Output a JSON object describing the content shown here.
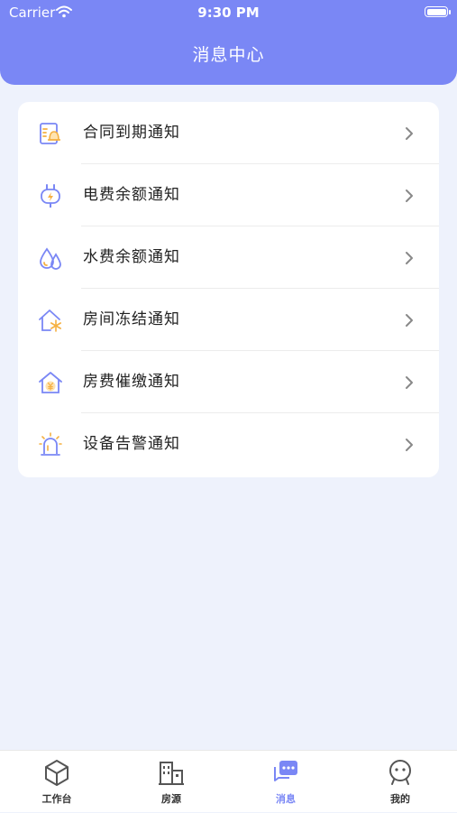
{
  "status_bar": {
    "carrier": "Carrier",
    "time": "9:30 PM"
  },
  "header": {
    "title": "消息中心"
  },
  "notifications": [
    {
      "label": "合同到期通知",
      "icon": "contract-bell-icon"
    },
    {
      "label": "电费余额通知",
      "icon": "power-plug-icon"
    },
    {
      "label": "水费余额通知",
      "icon": "water-drops-icon"
    },
    {
      "label": "房间冻结通知",
      "icon": "house-snowflake-icon"
    },
    {
      "label": "房费催缴通知",
      "icon": "house-yuan-icon"
    },
    {
      "label": "设备告警通知",
      "icon": "alarm-light-icon"
    }
  ],
  "tabbar": {
    "items": [
      {
        "label": "工作台",
        "icon": "cube-icon",
        "active": false
      },
      {
        "label": "房源",
        "icon": "buildings-icon",
        "active": false
      },
      {
        "label": "消息",
        "icon": "chat-icon",
        "active": true
      },
      {
        "label": "我的",
        "icon": "face-icon",
        "active": false
      }
    ]
  },
  "colors": {
    "primary": "#7a87f5",
    "icon_orange": "#f5b041",
    "background": "#eef2fc"
  }
}
